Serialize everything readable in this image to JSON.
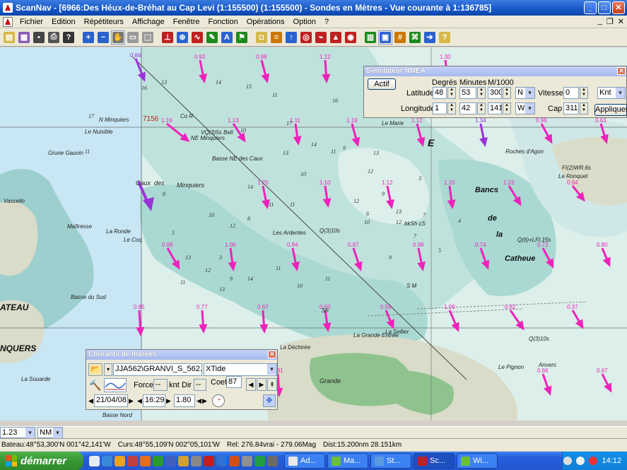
{
  "window": {
    "title": "ScanNav - [6966:Des Héux-de-Bréhat au Cap Levi (1:155500) (1:155500) - Sondes en  Mètres  - Vue courante à 1:136785]",
    "minimize": "_",
    "maximize": "□",
    "close": "✕"
  },
  "menu": {
    "items": [
      "Fichier",
      "Edition",
      "Répétiteurs",
      "Affichage",
      "Fenêtre",
      "Fonction",
      "Opérations",
      "Option",
      "?"
    ],
    "mdi_minimize": "_",
    "mdi_restore": "❐",
    "mdi_close": "✕"
  },
  "toolbar": {
    "icons": [
      {
        "name": "new-icon",
        "color": "#d6b84a"
      },
      {
        "name": "open-icon",
        "color": "#8a5cb8"
      },
      {
        "name": "save-icon",
        "color": "#444444"
      },
      {
        "name": "print-icon",
        "color": "#555555"
      },
      {
        "name": "help-icon",
        "color": "#333333"
      },
      {
        "name": "zoom-in-icon",
        "color": "#2a62cf"
      },
      {
        "name": "zoom-out-icon",
        "color": "#2a62cf"
      },
      {
        "name": "hand-icon",
        "color": "#777777"
      },
      {
        "name": "select-rect-icon",
        "color": "#999999"
      },
      {
        "name": "select-icon",
        "color": "#999999"
      },
      {
        "name": "route-icon",
        "color": "#c02020"
      },
      {
        "name": "crosshair-icon",
        "color": "#2a62cf"
      },
      {
        "name": "track-icon",
        "color": "#c02020"
      },
      {
        "name": "pencil-icon",
        "color": "#1c8a1c"
      },
      {
        "name": "text-icon",
        "color": "#2a62cf"
      },
      {
        "name": "waypoint-icon",
        "color": "#1c8a1c"
      },
      {
        "name": "gps-icon",
        "color": "#d6b84a"
      },
      {
        "name": "nmea-icon",
        "color": "#cc7700"
      },
      {
        "name": "up-icon",
        "color": "#2a62cf"
      },
      {
        "name": "target-icon",
        "color": "#c02020"
      },
      {
        "name": "route-plan-icon",
        "color": "#c02020"
      },
      {
        "name": "boat-icon",
        "color": "#c02020"
      },
      {
        "name": "lifebuoy-icon",
        "color": "#c02020"
      },
      {
        "name": "tide-icon",
        "color": "#1c8a1c"
      },
      {
        "name": "current-icon",
        "color": "#2a62cf"
      },
      {
        "name": "grid-icon",
        "color": "#cc7700"
      },
      {
        "name": "wind-icon",
        "color": "#1c8a1c"
      },
      {
        "name": "arrow-icon",
        "color": "#2a62cf"
      },
      {
        "name": "help-pointer-icon",
        "color": "#d6b84a"
      }
    ]
  },
  "map": {
    "colors": {
      "deep": "#dcefea",
      "mid": "#bfe2dc",
      "shallow": "#9fd1d0",
      "land": "#d9dcc9",
      "sea_light": "#c8e6f4",
      "arrow": "#ee22bb",
      "purple": "#9a32d8"
    },
    "place_labels": [
      "N Minquiers",
      "Le Nuisible",
      "Grune Gauvin",
      "Vascelin",
      "Maîtresse",
      "La Ronde",
      "Le Coq",
      "Basse du Sud",
      "ATEAU",
      "NQUERS",
      "La Souarde",
      "VQ(3)5s Bell",
      "NE Minquiers",
      "Basse NE des Caux",
      "Caux",
      "des",
      "Minquiers",
      "Les Ardentes",
      "Q(3)10s",
      "Le Marie",
      "Roches d'Agon",
      "Le Ronquet",
      "Bancs",
      "de",
      "la",
      "Catheue",
      "Q(6)+LFI.15s",
      "La Grande Entrée",
      "La Sellier",
      "Anvers",
      "Le Pignon",
      "Grande",
      "Basse Nord",
      "La Déchirée",
      "Q(3)10s",
      "FI(2)WR.6s",
      "E",
      "Co R",
      "Sh",
      "bkSh cS",
      "S M"
    ],
    "chart_number": "7156",
    "arrow_values": [
      "0.84",
      "0.92",
      "0.98",
      "1.12",
      "1.30",
      "1.19",
      "1.13",
      "1.11",
      "1.19",
      "1.12",
      "1.34",
      "0.96",
      "0.63",
      "1.25",
      "1.10",
      "1.12",
      "1.15",
      "1.23",
      "0.94",
      "0.86",
      "1.06",
      "0.94",
      "0.97",
      "0.98",
      "0.74",
      "0.72",
      "0.80",
      "0.85",
      "0.77",
      "0.67",
      "0.50",
      "0.59",
      "1.09",
      "0.82",
      "0.37",
      "0.81",
      "0.66",
      "0.67"
    ],
    "depths": [
      "13",
      "14",
      "15",
      "16",
      "11",
      "16",
      "17",
      "17",
      "10",
      "14",
      "13",
      "9",
      "13",
      "11",
      "8",
      "10",
      "11",
      "12",
      "9",
      "3",
      "7",
      "11",
      "12",
      "13",
      "14",
      "10",
      "12",
      "5",
      "3",
      "9",
      "8",
      "11",
      "13",
      "10",
      "12",
      "6",
      "7",
      "4",
      "11",
      "12",
      "13",
      "14",
      "11",
      "5",
      "9",
      "10",
      "11"
    ]
  },
  "nmea": {
    "title": "Simulateur NMEA",
    "active_button": "Actif",
    "hdr_degres": "Degrés",
    "hdr_minutes": "Minutes",
    "hdr_m1000": "M/1000",
    "lat_label": "Latitude",
    "lat_deg": "48",
    "lat_min": "53",
    "lat_thou": "300",
    "lat_hemi": "N",
    "lon_label": "Longitude",
    "lon_deg": "1",
    "lon_min": "42",
    "lon_thou": "141",
    "lon_hemi": "W",
    "speed_label": "Vitesse",
    "speed_value": "0",
    "speed_unit": "Knt",
    "heading_label": "Cap",
    "heading_value": "311",
    "apply_button": "Appliquer"
  },
  "tides": {
    "title": "Courants de marées",
    "file": "JJA562\\GRANVI_S_562.cur",
    "engine": "XTide",
    "force_label": "Force",
    "force_value": "--",
    "force_unit": "knt",
    "dir_label": "Dir",
    "dir_value": "--",
    "coef_label": "Coef",
    "coef_value": "87",
    "date": "21/04/08",
    "time": "16:29",
    "height": "1.80"
  },
  "status": {
    "scale": "1.23",
    "unit": "NM",
    "boat": "Bateau:48°53,300'N 001°42,141'W",
    "cursor": "Curs:48°55,109'N 002°05,101'W",
    "bearing": "Rel: 276.84vrai - 279.06Mag",
    "distance": "Dist:15.200nm  28.151km"
  },
  "taskbar": {
    "start": "démarrer",
    "tasks": [
      {
        "label": "Ad...",
        "color": "#e8e8e8"
      },
      {
        "label": "Ma...",
        "color": "#6bbf3a"
      },
      {
        "label": "St...",
        "color": "#5a9adf"
      },
      {
        "label": "Sc...",
        "color": "#c02020"
      },
      {
        "label": "Wi...",
        "color": "#6bbf3a"
      }
    ],
    "quicklaunch": [
      "#e6edf8",
      "#3a88d8",
      "#f0a020",
      "#c04040",
      "#e86c1a",
      "#2a9a2a",
      "#4060c0",
      "#d0a030",
      "#888888",
      "#c02020",
      "#3070d0",
      "#d05010",
      "#909090",
      "#20a040",
      "#6a6a6a"
    ],
    "clock": "14:12"
  }
}
